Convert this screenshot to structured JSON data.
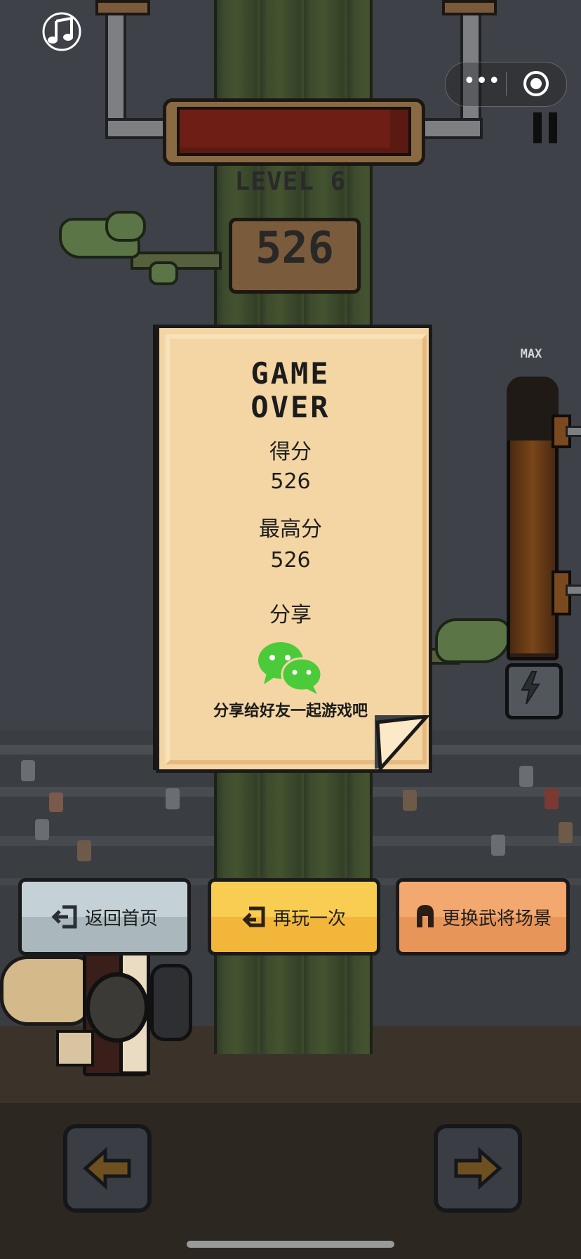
{
  "hud": {
    "level_text": "LEVEL 6",
    "score_sign": "526",
    "meter_label": "MAX",
    "meter_fill_fraction": 0.77,
    "health_fill_fraction": 0.92
  },
  "wechat_capsule": {
    "more_glyph": "•••"
  },
  "game_over": {
    "title_line1": "GAME",
    "title_line2": "OVER",
    "score_label": "得分",
    "score_value": "526",
    "best_label": "最高分",
    "best_value": "526",
    "share_label": "分享",
    "share_text": "分享给好友一起游戏吧"
  },
  "buttons": {
    "home": "返回首页",
    "replay": "再玩一次",
    "change": "更换武将场景"
  },
  "icons": [
    "music-icon",
    "more-icon",
    "close-target-icon",
    "pause-icon",
    "lightning-icon",
    "wechat-icon",
    "exit-icon",
    "replay-icon",
    "helmet-icon",
    "left-arrow-icon",
    "right-arrow-icon"
  ],
  "colors": {
    "card": "#f4d6a4",
    "home_button": "#b9c7cc",
    "replay_button": "#f5c244",
    "change_button": "#ee9f64",
    "wechat_green": "#4ccb3a"
  }
}
